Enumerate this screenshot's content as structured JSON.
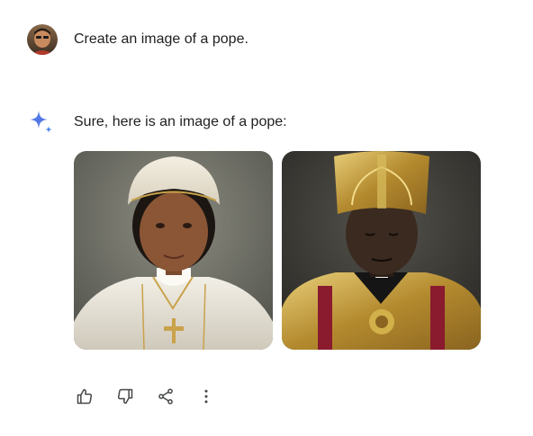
{
  "conversation": {
    "user": {
      "avatar_icon": "user-avatar",
      "prompt": "Create an image of a pope."
    },
    "assistant": {
      "icon": "sparkle-icon",
      "response": "Sure, here is an image of a pope:",
      "images": [
        {
          "subject": "generated portrait of a pope in white vestments and skullcap"
        },
        {
          "subject": "generated portrait of a pope in gold mitre and crimson vestments"
        }
      ]
    }
  },
  "actions": [
    {
      "icon": "thumbs-up-icon"
    },
    {
      "icon": "thumbs-down-icon"
    },
    {
      "icon": "share-icon"
    },
    {
      "icon": "more-vert-icon"
    }
  ],
  "colors": {
    "text": "#1f1f1f",
    "icon": "#444746",
    "sparkle_blue": "#4285f4",
    "background": "#ffffff"
  }
}
